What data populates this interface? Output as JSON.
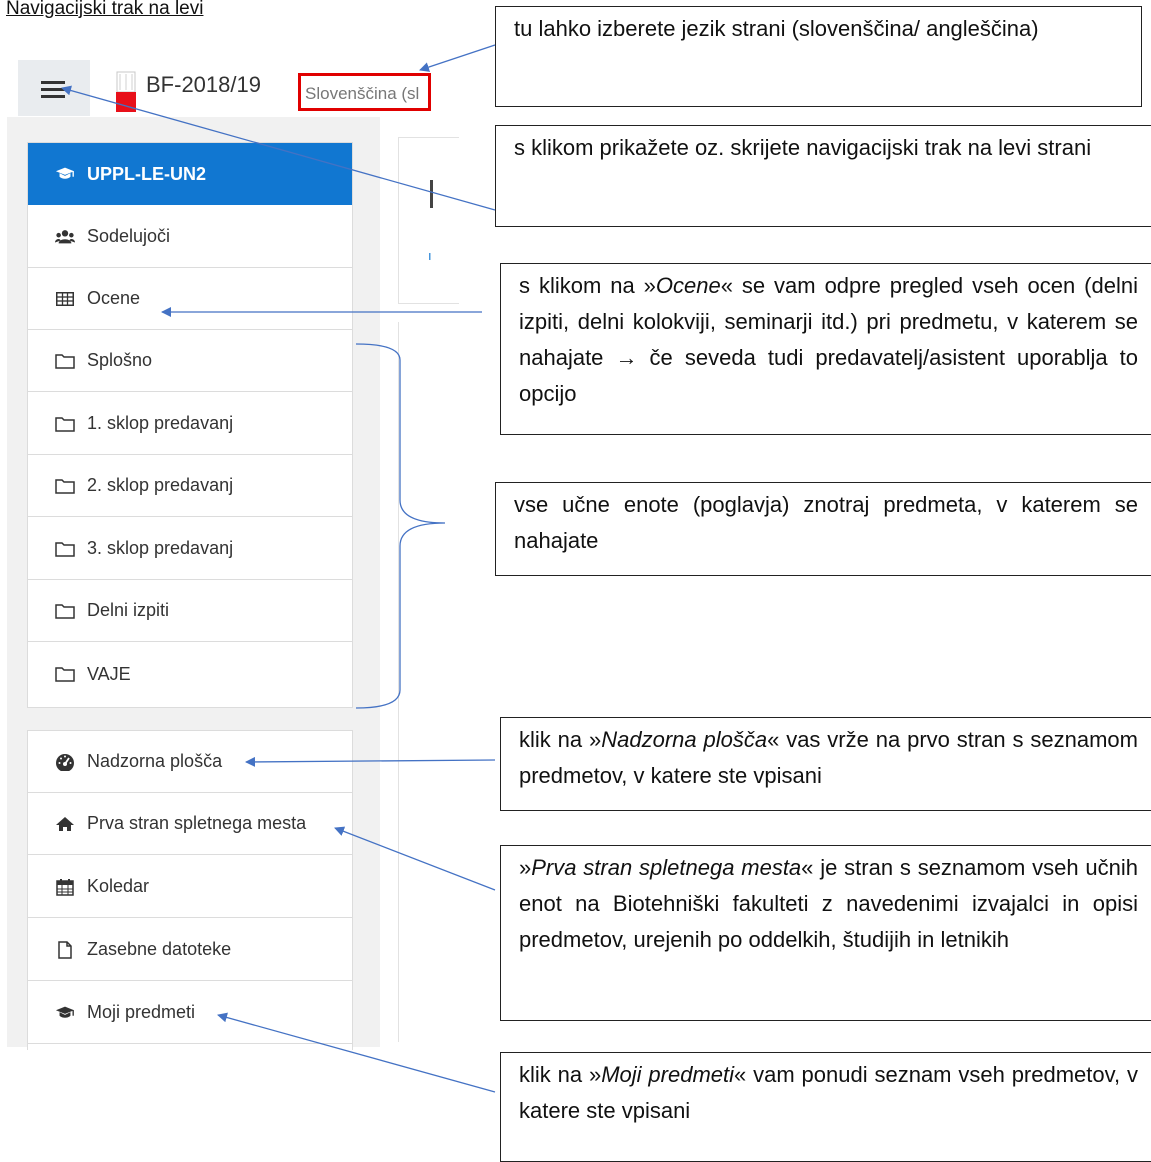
{
  "heading": "Navigacijski trak na levi",
  "site_name": "BF-2018/19",
  "language_selector": "Slovenščina (sl",
  "course": {
    "label": "UPPL-LE-UN2",
    "icon": "graduation-cap-icon"
  },
  "course_nav": [
    {
      "label": "Sodelujoči",
      "icon": "users-icon"
    },
    {
      "label": "Ocene",
      "icon": "table-icon"
    },
    {
      "label": "Splošno",
      "icon": "folder-icon"
    },
    {
      "label": "1. sklop predavanj",
      "icon": "folder-icon"
    },
    {
      "label": "2. sklop predavanj",
      "icon": "folder-icon"
    },
    {
      "label": "3. sklop predavanj",
      "icon": "folder-icon"
    },
    {
      "label": "Delni izpiti",
      "icon": "folder-icon"
    },
    {
      "label": "VAJE",
      "icon": "folder-icon"
    }
  ],
  "site_nav": [
    {
      "label": "Nadzorna plošča",
      "icon": "dashboard-icon"
    },
    {
      "label": "Prva stran spletnega mesta",
      "icon": "home-icon"
    },
    {
      "label": "Koledar",
      "icon": "calendar-icon"
    },
    {
      "label": "Zasebne datoteke",
      "icon": "file-icon"
    },
    {
      "label": "Moji predmeti",
      "icon": "graduation-cap-icon"
    }
  ],
  "notes": {
    "language": "tu lahko izberete jezik strani (slovenščina/ angleščina)",
    "toggle": "s klikom prikažete oz. skrijete navigacijski trak na levi strani",
    "grades_prefix": "s klikom na »",
    "grades_term": "Ocene",
    "grades_suffix": "« se vam odpre pregled vseh ocen (delni izpiti, delni kolokviji, seminarji itd.) pri predmetu, v katerem se nahajate → če seveda tudi predavatelj/asistent uporablja to opcijo",
    "sections": "vse učne enote (poglavja) znotraj predmeta, v katerem se nahajate",
    "dashboard_prefix": "klik na »",
    "dashboard_term": "Nadzorna plošča",
    "dashboard_suffix": "« vas vrže na prvo stran s seznamom predmetov, v katere ste vpisani",
    "home_prefix": "»",
    "home_term": "Prva stran spletnega mesta",
    "home_suffix": "« je stran s seznamom vseh učnih enot na Biotehniški fakulteti z navedenimi izvajalci in opisi predmetov, urejenih po oddelkih, študijih in letnikih",
    "courses_prefix": "klik na »",
    "courses_term": "Moji predmeti",
    "courses_suffix": "« vam ponudi seznam vseh predmetov, v katere ste vpisani"
  }
}
